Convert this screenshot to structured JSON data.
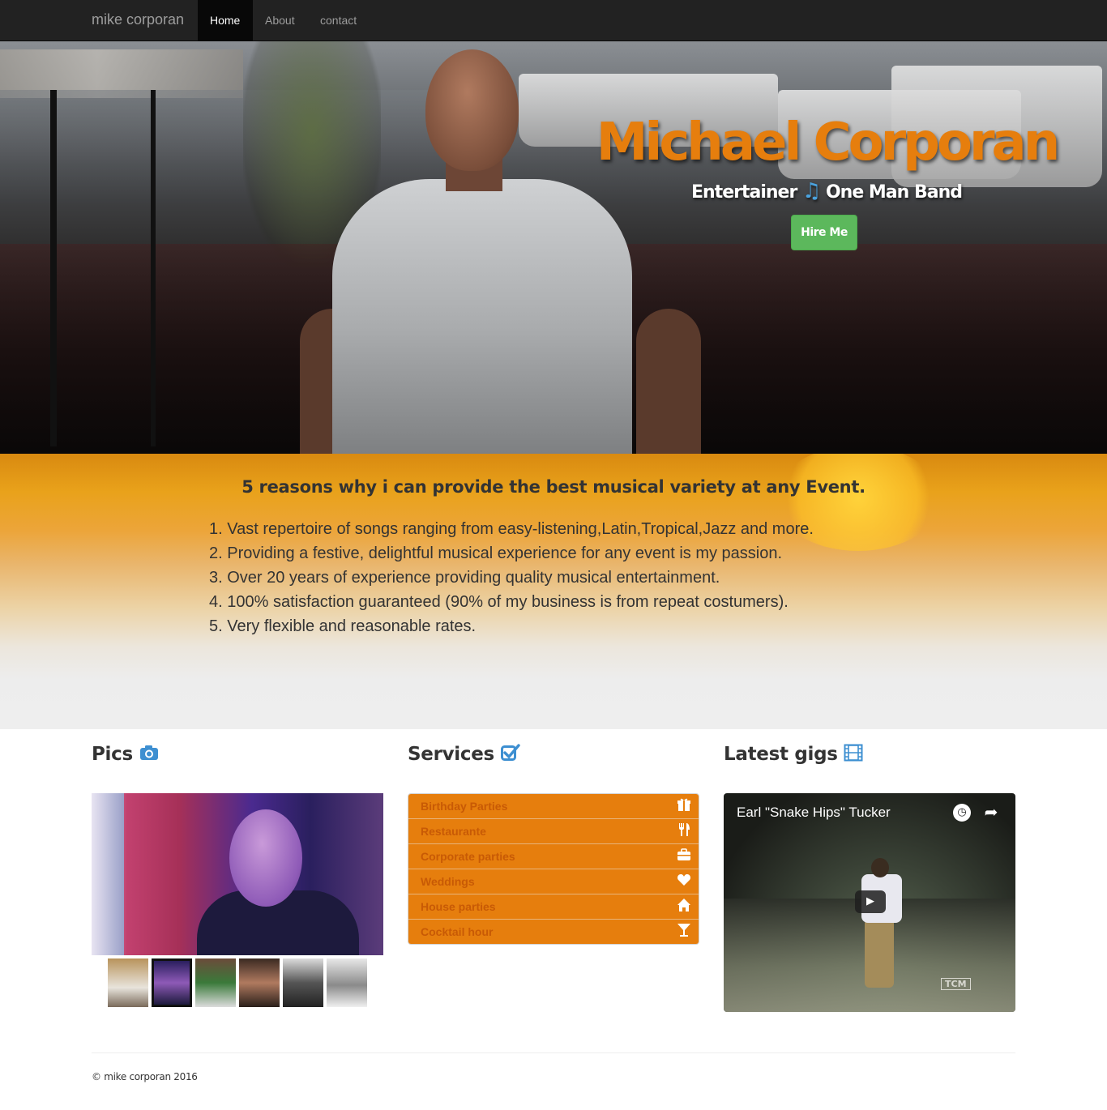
{
  "nav": {
    "brand": "mike corporan",
    "items": [
      {
        "label": "Home",
        "active": true
      },
      {
        "label": "About",
        "active": false
      },
      {
        "label": "contact",
        "active": false
      }
    ]
  },
  "hero": {
    "title": "Michael Corporan",
    "subtitle_left": "Entertainer",
    "subtitle_icon": "music-note-icon",
    "subtitle_right": "One Man Band",
    "cta_label": "Hire Me",
    "cta_color": "#5cb85c",
    "title_color": "#e67e0d"
  },
  "reasons": {
    "title": "5 reasons why i can provide the best musical variety at any Event.",
    "items": [
      "1. Vast repertoire of songs ranging from easy-listening,Latin,Tropical,Jazz and more.",
      "2. Providing a festive, delightful musical experience for any event is my passion.",
      "3. Over 20 years of experience providing quality musical entertainment.",
      "4. 100% satisfaction guaranteed (90% of my business is from repeat costumers).",
      "5. Very flexible and reasonable rates."
    ]
  },
  "pics": {
    "heading": "Pics",
    "heading_icon": "camera-icon",
    "thumb_count": 6
  },
  "services": {
    "heading": "Services",
    "heading_icon": "check-square-icon",
    "accent": "#e67e0d",
    "items": [
      {
        "label": "Birthday Parties",
        "icon": "gift-icon",
        "glyph": "⌧"
      },
      {
        "label": "Restaurante",
        "icon": "cutlery-icon",
        "glyph": "Ψ"
      },
      {
        "label": "Corporate parties",
        "icon": "briefcase-icon",
        "glyph": "▤"
      },
      {
        "label": "Weddings",
        "icon": "heart-icon",
        "glyph": "♥"
      },
      {
        "label": "House parties",
        "icon": "home-icon",
        "glyph": "⌂"
      },
      {
        "label": "Cocktail hour",
        "icon": "glass-icon",
        "glyph": "Y"
      }
    ]
  },
  "gigs": {
    "heading": "Latest gigs",
    "heading_icon": "film-icon",
    "video_title": "Earl \"Snake Hips\" Tucker",
    "watermark": "TCM"
  },
  "footer": {
    "text": "© mike corporan 2016"
  }
}
